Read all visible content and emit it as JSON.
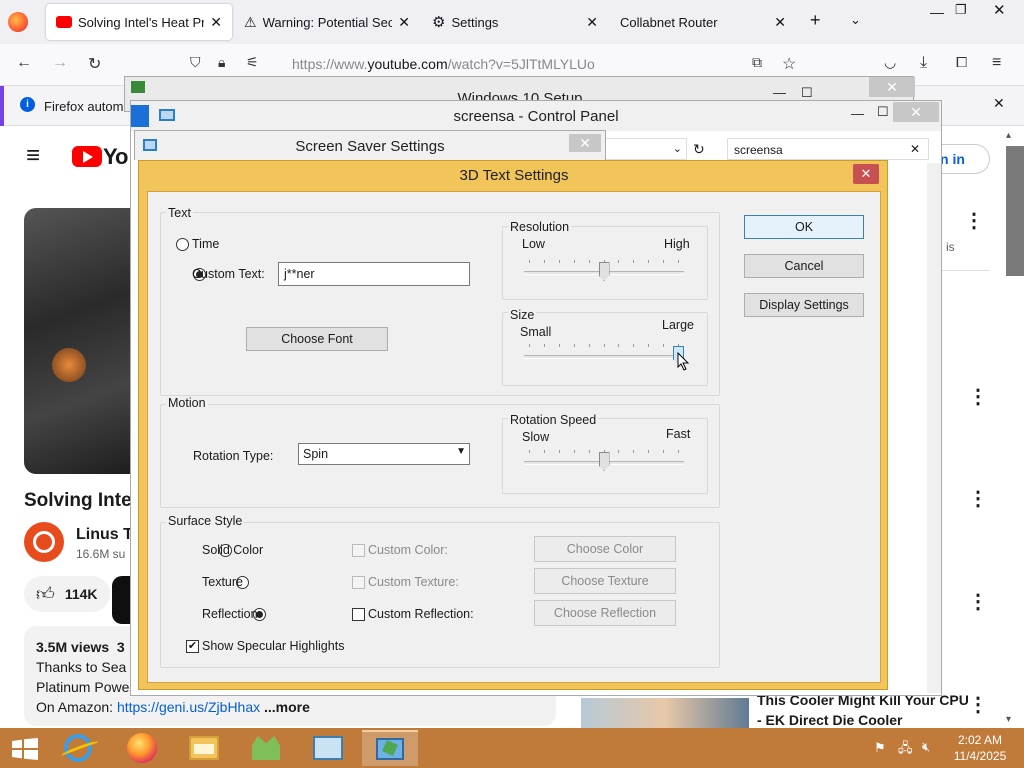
{
  "browser": {
    "tabs": [
      {
        "title": "Solving Intel's Heat Prob",
        "active": true
      },
      {
        "title": "Warning: Potential Secur",
        "active": false
      },
      {
        "title": "Settings",
        "active": false
      },
      {
        "title": "Collabnet Router",
        "active": false
      }
    ],
    "url_prefix": "https://www.",
    "url_domain": "youtube.com",
    "url_path": "/watch?v=5JlTtMLYLUo",
    "notification": "Firefox automa"
  },
  "youtube": {
    "logo_text": "Yo",
    "signin": "n in",
    "video_title": "Solving Inte",
    "channel_name": "Linus T",
    "subs": "16.6M su",
    "likes": "114K",
    "views": "3.5M views  3",
    "desc_line1": "Thanks to Sea",
    "desc_line2": "Platinum Power",
    "desc_line3": "On Amazon: ",
    "desc_link": "https://geni.us/ZjbHhax",
    "more": "...more",
    "side_title1": "This Cooler Might Kill Your CPU",
    "side_title2": "- EK Direct Die Cooler",
    "side_is": "is"
  },
  "windows": {
    "setup_title": "Windows 10 Setup",
    "cp_title": "screensa - Control Panel",
    "cp_search": "screensa",
    "ss_title": "Screen Saver Settings"
  },
  "dialog": {
    "title": "3D Text Settings",
    "close": "✕",
    "text_group": "Text",
    "time_label": "Time",
    "custom_text_label": "Custom Text:",
    "custom_text_value": "j**ner",
    "choose_font": "Choose Font",
    "resolution_group": "Resolution",
    "res_low": "Low",
    "res_high": "High",
    "res_value": 0.5,
    "size_group": "Size",
    "size_small": "Small",
    "size_large": "Large",
    "size_value": 1.0,
    "motion_group": "Motion",
    "rotation_type_label": "Rotation Type:",
    "rotation_type_value": "Spin",
    "rotation_speed_group": "Rotation Speed",
    "speed_slow": "Slow",
    "speed_fast": "Fast",
    "speed_value": 0.5,
    "surface_group": "Surface Style",
    "solid_color": "Solid Color",
    "texture": "Texture",
    "reflection": "Reflection",
    "custom_color": "Custom Color:",
    "custom_texture": "Custom Texture:",
    "custom_reflection": "Custom Reflection:",
    "choose_color": "Choose Color",
    "choose_texture": "Choose Texture",
    "choose_reflection": "Choose Reflection",
    "specular": "Show Specular Highlights",
    "ok": "OK",
    "cancel": "Cancel",
    "display_settings": "Display Settings"
  },
  "taskbar": {
    "time": "2:02 AM",
    "date": "11/4/2025"
  }
}
